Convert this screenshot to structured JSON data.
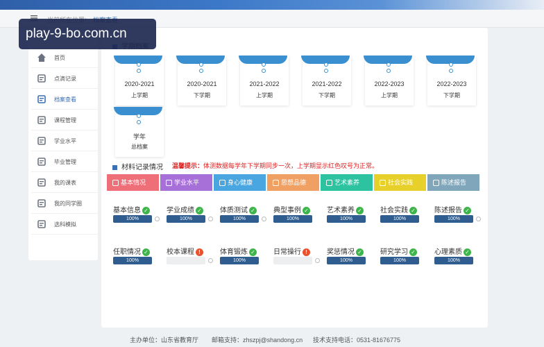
{
  "breadcrumb": {
    "prefix": "当前所在位置",
    "separator": "›",
    "current": "档案查看"
  },
  "watermark": "play-9-bo.com.cn",
  "sidebar": {
    "items": [
      {
        "label": "首页",
        "icon": "home-icon"
      },
      {
        "label": "点滴记录",
        "icon": "edit-icon"
      },
      {
        "label": "档案查看",
        "icon": "archive-icon"
      },
      {
        "label": "课程管理",
        "icon": "course-icon"
      },
      {
        "label": "学业水平",
        "icon": "user-icon"
      },
      {
        "label": "毕业管理",
        "icon": "graduate-icon"
      },
      {
        "label": "我的课表",
        "icon": "schedule-icon"
      },
      {
        "label": "我的同学圈",
        "icon": "classmates-icon"
      },
      {
        "label": "选科模拟",
        "icon": "clipboard-icon"
      }
    ]
  },
  "main": {
    "semester_title": "学期档案",
    "semesters": [
      {
        "year": "2020-2021",
        "term": "上学期"
      },
      {
        "year": "2020-2021",
        "term": "下学期"
      },
      {
        "year": "2021-2022",
        "term": "上学期"
      },
      {
        "year": "2021-2022",
        "term": "下学期"
      },
      {
        "year": "2022-2023",
        "term": "上学期"
      },
      {
        "year": "2022-2023",
        "term": "下学期"
      },
      {
        "year": "学年",
        "term": "总档案"
      }
    ],
    "material_title": "材料记录情况",
    "warn_label": "温馨提示：",
    "warn_text": "体测数据每学年下学期同步一次，上学期显示红色叹号为正常。",
    "categories": [
      {
        "label": "基本情况",
        "color": "#ee6f78"
      },
      {
        "label": "学业水平",
        "color": "#a670d8"
      },
      {
        "label": "身心健康",
        "color": "#4aa6e0"
      },
      {
        "label": "思想品德",
        "color": "#f0a063"
      },
      {
        "label": "艺术素养",
        "color": "#2ec3a0"
      },
      {
        "label": "社会实践",
        "color": "#e8d02a"
      },
      {
        "label": "陈述报告",
        "color": "#7fa6bb"
      }
    ],
    "items": [
      {
        "label": "基本信息",
        "status": "ok",
        "progress": "100%",
        "value": 1.0,
        "help": true
      },
      {
        "label": "学业成绩",
        "status": "ok",
        "progress": "100%",
        "value": 1.0,
        "help": true
      },
      {
        "label": "体质测试",
        "status": "ok",
        "progress": "100%",
        "value": 1.0,
        "help": true
      },
      {
        "label": "典型事例",
        "status": "ok",
        "progress": "100%",
        "value": 1.0,
        "help": false
      },
      {
        "label": "艺术素养",
        "status": "ok",
        "progress": "100%",
        "value": 1.0,
        "help": false
      },
      {
        "label": "社会实践",
        "status": "ok",
        "progress": "100%",
        "value": 1.0,
        "help": false
      },
      {
        "label": "陈述报告",
        "status": "ok",
        "progress": "100%",
        "value": 1.0,
        "help": true
      },
      {
        "label": "任职情况",
        "status": "ok",
        "progress": "100%",
        "value": 1.0,
        "help": false
      },
      {
        "label": "校本课程",
        "status": "bad",
        "progress": "",
        "value": 0,
        "help": true
      },
      {
        "label": "体育锻炼",
        "status": "ok",
        "progress": "100%",
        "value": 1.0,
        "help": false
      },
      {
        "label": "日常操行",
        "status": "bad",
        "progress": "",
        "value": 0,
        "help": true
      },
      {
        "label": "奖惩情况",
        "status": "ok",
        "progress": "100%",
        "value": 1.0,
        "help": false
      },
      {
        "label": "研究学习",
        "status": "ok",
        "progress": "100%",
        "value": 1.0,
        "help": false
      },
      {
        "label": "心理素质",
        "status": "ok",
        "progress": "100%",
        "value": 1.0,
        "help": false
      }
    ]
  },
  "footer": {
    "host": "主办单位：山东省教育厅",
    "email": "邮箱支持：zhszpj@shandong.cn",
    "phone": "技术支持电话：0531-81676775"
  },
  "colors": {
    "primary": "#3a6fb5",
    "progress": "#2f5d8f",
    "ok": "#3db54a",
    "warn": "#e8522f"
  }
}
